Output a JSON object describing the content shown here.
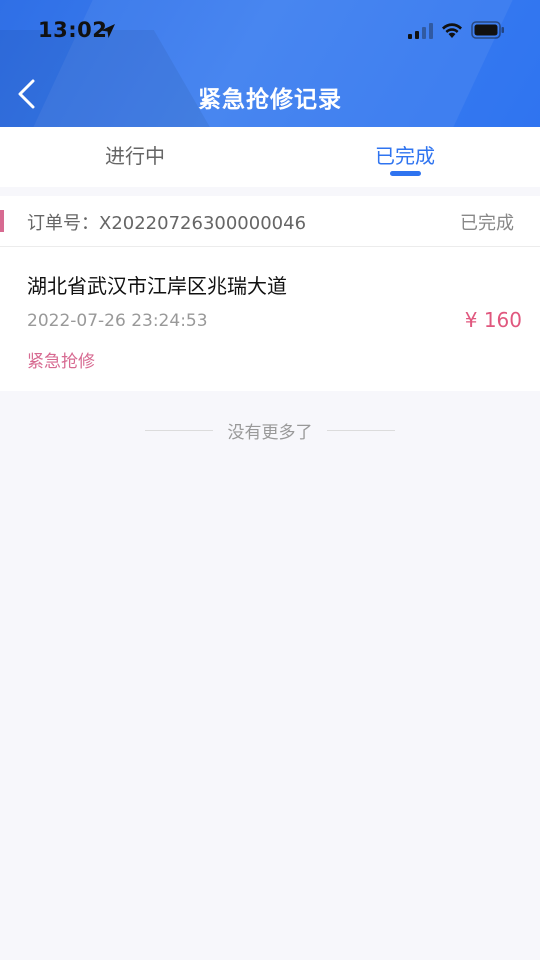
{
  "status_bar": {
    "time": "13:02"
  },
  "nav": {
    "title": "紧急抢修记录"
  },
  "tabs": [
    {
      "label": "进行中",
      "active": false
    },
    {
      "label": "已完成",
      "active": true
    }
  ],
  "order": {
    "order_label": "订单号：X20220726300000046",
    "status": "已完成",
    "address": "湖北省武汉市江岸区兆瑞大道",
    "datetime": "2022-07-26 23:24:53",
    "price": "¥ 160",
    "service_type": "紧急抢修"
  },
  "list_end_text": "没有更多了",
  "colors": {
    "header_blue": "#2f74f0",
    "accent_pink": "#d76a91",
    "price_red": "#e0577e"
  }
}
